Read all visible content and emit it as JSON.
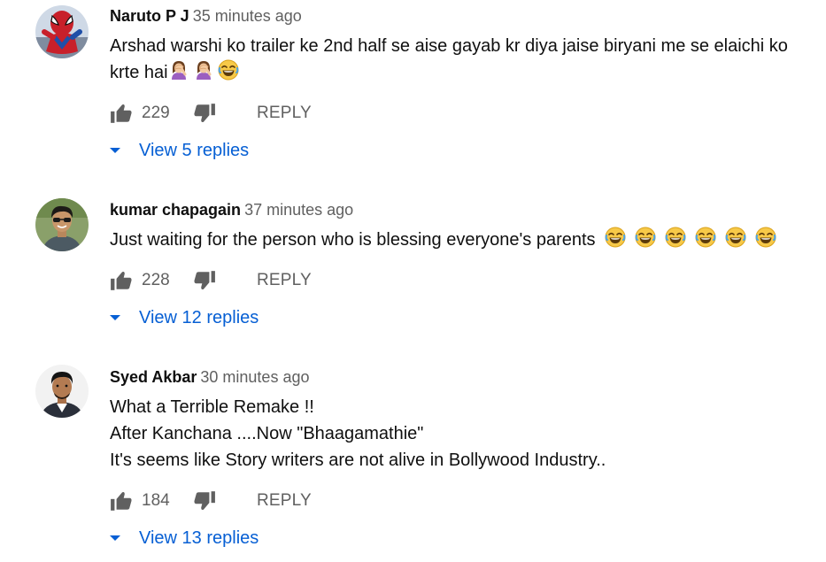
{
  "comments": [
    {
      "author": "Naruto P J",
      "time": "35 minutes ago",
      "lines": [
        "Arshad warshi ko trailer ke 2nd half se aise gayab kr diya jaise biryani me se elaichi ko",
        "krte hai"
      ],
      "emojis": [
        "person-facepalming",
        "person-facepalming",
        "face-with-tears-of-joy"
      ],
      "likes": "229",
      "reply_label": "REPLY",
      "view_replies": "View 5 replies",
      "avatar_icon": "spiderman-avatar"
    },
    {
      "author": "kumar chapagain",
      "time": "37 minutes ago",
      "lines": [
        "Just waiting for the person who is blessing everyone's parents"
      ],
      "emojis": [
        "face-with-tears-of-joy",
        "face-with-tears-of-joy",
        "face-with-tears-of-joy",
        "face-with-tears-of-joy",
        "face-with-tears-of-joy",
        "face-with-tears-of-joy"
      ],
      "likes": "228",
      "reply_label": "REPLY",
      "view_replies": "View 12 replies",
      "avatar_icon": "person-photo-avatar"
    },
    {
      "author": "Syed Akbar",
      "time": "30 minutes ago",
      "lines": [
        "What a Terrible Remake !!",
        "After Kanchana ....Now \"Bhaagamathie\"",
        "It's seems like Story writers are not alive in Bollywood Industry.."
      ],
      "emojis": [],
      "likes": "184",
      "reply_label": "REPLY",
      "view_replies": "View 13 replies",
      "avatar_icon": "person-photo-avatar"
    }
  ],
  "colors": {
    "link": "#065fd4",
    "secondary": "#606060",
    "primary": "#0f0f0f"
  }
}
